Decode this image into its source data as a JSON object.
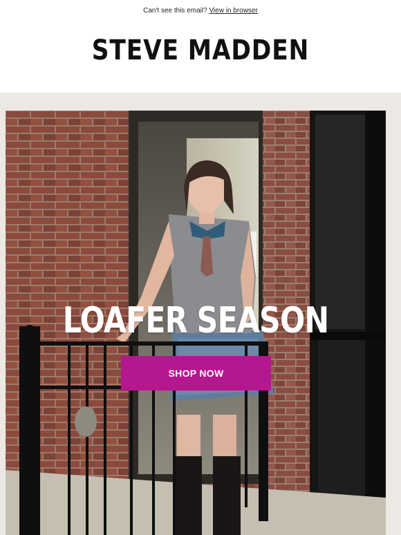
{
  "preheader": {
    "text": "Can't see this email?",
    "link_label": "View in browser"
  },
  "brand": {
    "logo_text": "STEVE MADDEN"
  },
  "hero": {
    "headline": "LOAFER SEASON",
    "cta_label": "SHOP NOW",
    "cta_color": "#b5178e"
  }
}
